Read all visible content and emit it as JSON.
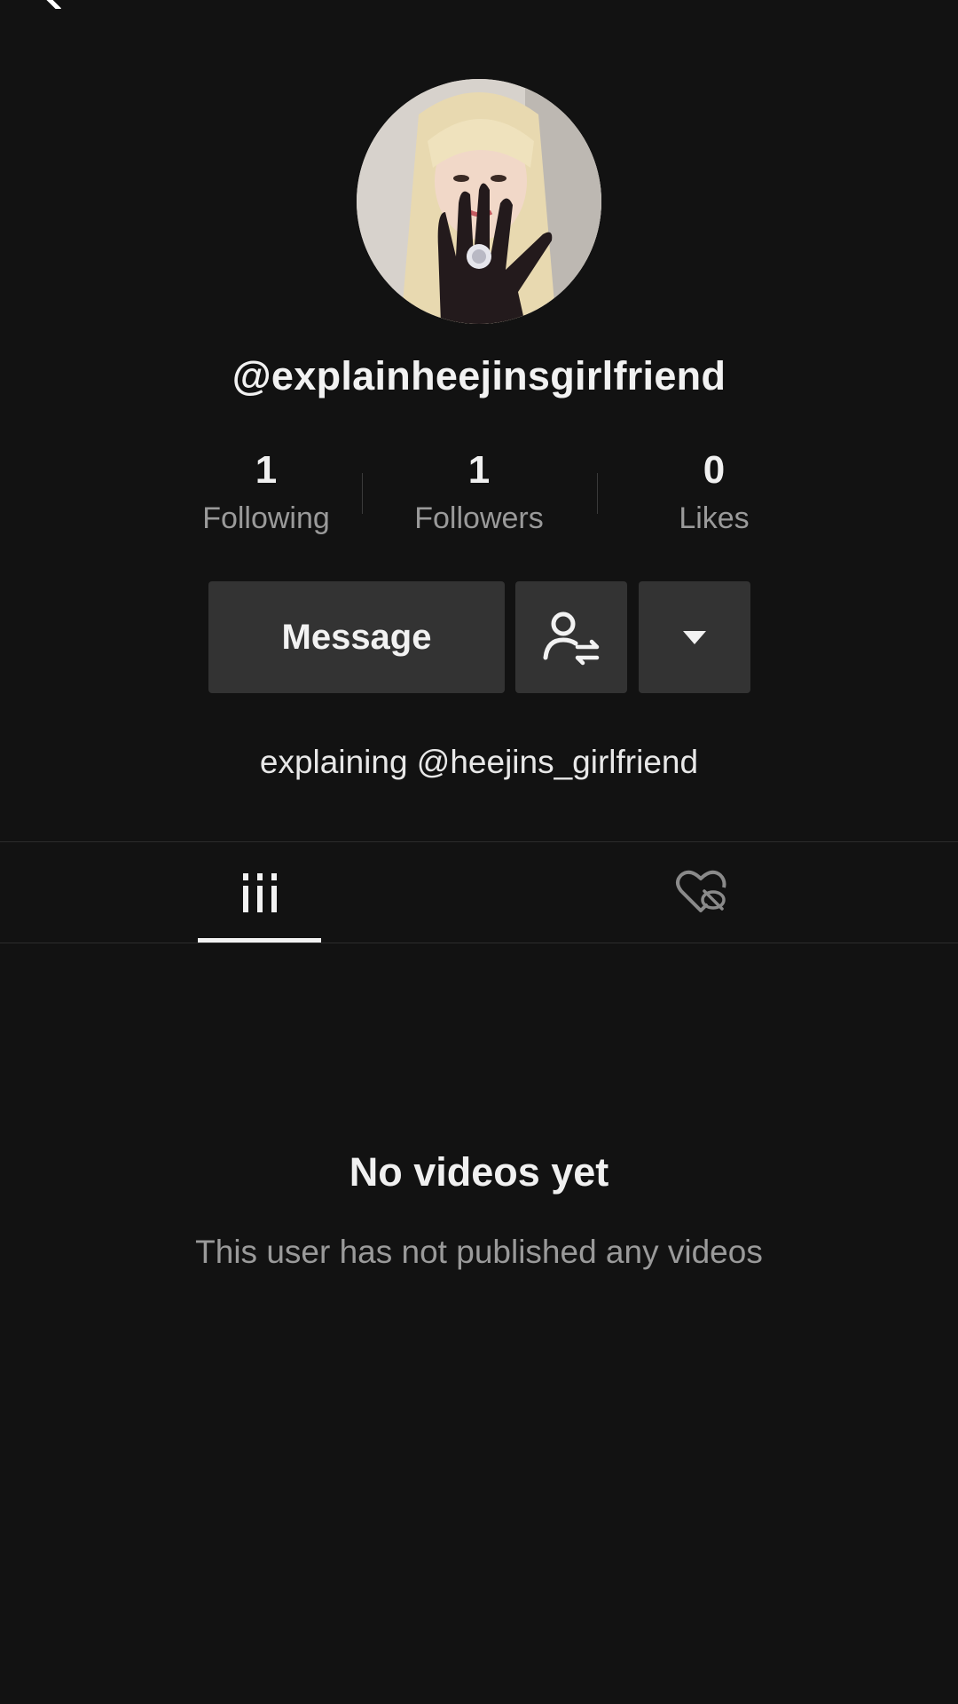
{
  "header": {
    "back_icon": "chevron-left-icon"
  },
  "profile": {
    "username": "@explainheejinsgirlfriend",
    "bio": "explaining @heejins_girlfriend"
  },
  "stats": [
    {
      "value": "1",
      "label": "Following"
    },
    {
      "value": "1",
      "label": "Followers"
    },
    {
      "value": "0",
      "label": "Likes"
    }
  ],
  "actions": {
    "message_label": "Message",
    "follow_icon": "user-switch-icon",
    "more_icon": "caret-down-icon"
  },
  "tabs": [
    {
      "name": "videos",
      "icon": "grid-lines-icon",
      "active": true
    },
    {
      "name": "liked",
      "icon": "heart-hidden-icon",
      "active": false
    }
  ],
  "empty_state": {
    "title": "No videos yet",
    "subtitle": "This user has not published any videos"
  },
  "colors": {
    "background": "#121212",
    "button": "#333333",
    "muted_text": "#9a9a9a"
  }
}
